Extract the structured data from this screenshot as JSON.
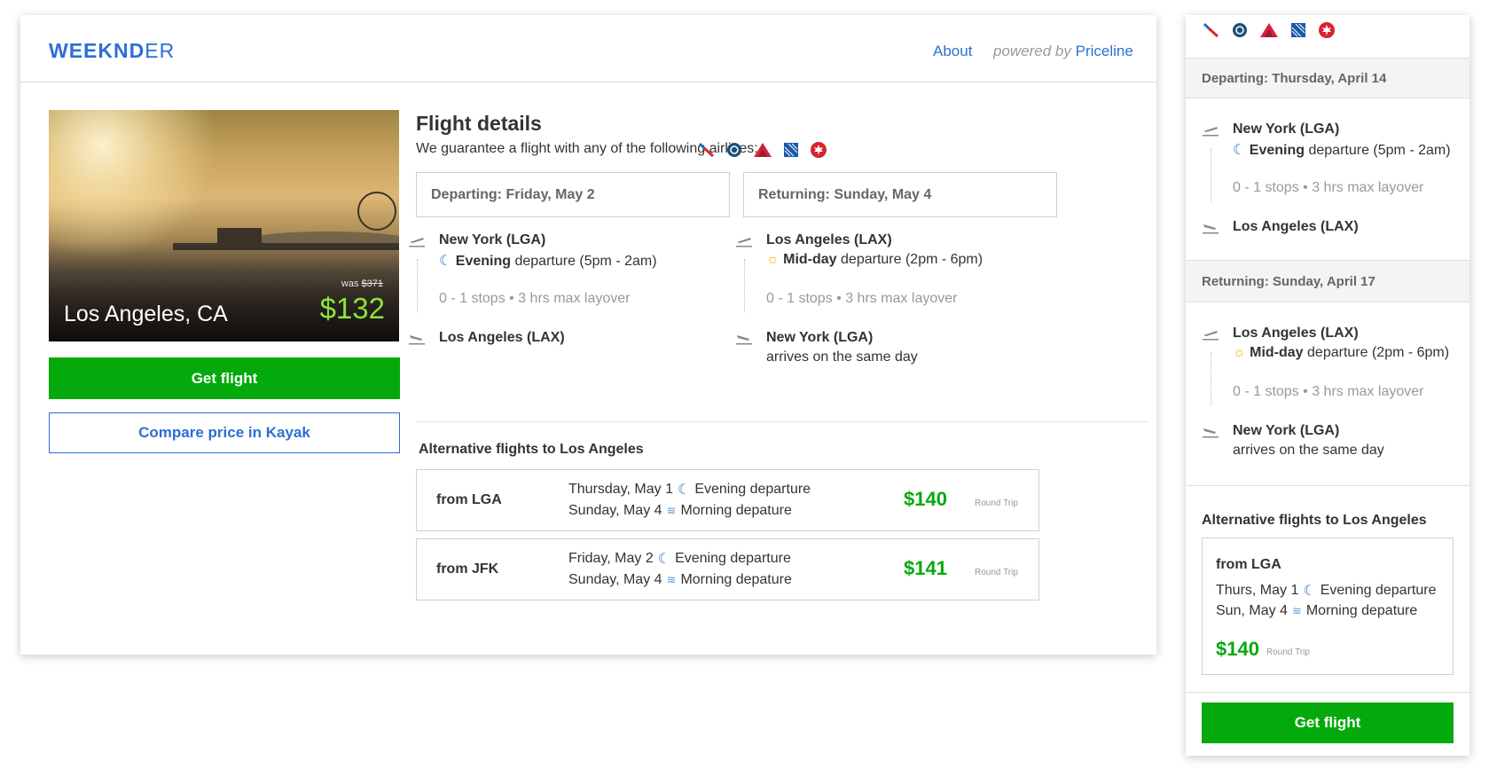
{
  "app": {
    "logo_bold": "WEEKND",
    "logo_thin": "ER",
    "nav_about": "About",
    "powered_by": "powered by",
    "powered_brand": "Priceline"
  },
  "hero": {
    "city": "Los Angeles, CA",
    "was_label": "was ",
    "was_price": "$371",
    "price": "$132"
  },
  "buttons": {
    "get_flight": "Get flight",
    "compare_kayak": "Compare price in Kayak"
  },
  "flight_details": {
    "title": "Flight details",
    "subtitle": "We guarantee a flight with any of the following airlines:",
    "airline_icons": [
      "american-airlines-icon",
      "alaska-icon",
      "delta-icon",
      "united-icon",
      "air-canada-icon"
    ],
    "departing": {
      "header": "Departing: Friday, May 2",
      "origin": "New York (LGA)",
      "time_bold": "Evening",
      "time_rest": " departure (5pm - 2am)",
      "stops": "0 - 1 stops • 3 hrs max layover",
      "destination": "Los Angeles (LAX)"
    },
    "returning": {
      "header": "Returning: Sunday, May 4",
      "origin": "Los Angeles (LAX)",
      "time_bold": "Mid-day",
      "time_rest": " departure (2pm - 6pm)",
      "stops": "0 - 1 stops • 3 hrs max layover",
      "destination": "New York (LGA)",
      "arrival_note": "arrives on the same day"
    }
  },
  "alternatives": {
    "title": "Alternative flights to Los Angeles",
    "rows": [
      {
        "from": "from LGA",
        "out_date": "Thursday, May 1",
        "out_time": "Evening departure",
        "ret_date": "Sunday, May 4",
        "ret_time": "Morning depature",
        "price": "$140",
        "trip": "Round Trip"
      },
      {
        "from": "from JFK",
        "out_date": "Friday, May 2",
        "out_time": "Evening departure",
        "ret_date": "Sunday, May 4",
        "ret_time": "Morning depature",
        "price": "$141",
        "trip": "Round Trip"
      }
    ]
  },
  "mobile": {
    "departing": {
      "header": "Departing: Thursday, April 14",
      "origin": "New York (LGA)",
      "time_bold": "Evening",
      "time_rest": " departure (5pm - 2am)",
      "stops": "0 - 1 stops • 3 hrs max layover",
      "destination": "Los Angeles (LAX)"
    },
    "returning": {
      "header": "Returning: Sunday, April 17",
      "origin": "Los Angeles (LAX)",
      "time_bold": "Mid-day",
      "time_rest": " departure (2pm - 6pm)",
      "stops": "0 - 1 stops • 3 hrs max layover",
      "destination": "New York (LGA)",
      "arrival_note": "arrives on the same day"
    },
    "alt_title": "Alternative flights to Los Angeles",
    "alt": {
      "from": "from LGA",
      "out_date": "Thurs, May 1",
      "out_time": "Evening departure",
      "ret_date": "Sun, May 4",
      "ret_time": "Morning depature",
      "price": "$140",
      "trip": "Round Trip"
    },
    "get_flight": "Get flight"
  },
  "colors": {
    "brand_blue": "#2c6fd4",
    "cta_green": "#04a90b",
    "price_green": "#8be33c"
  }
}
